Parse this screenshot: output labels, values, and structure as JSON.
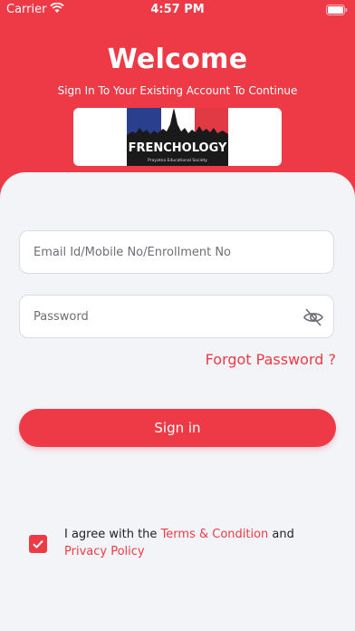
{
  "status_bar": {
    "carrier": "Carrier",
    "time": "4:57 PM"
  },
  "header": {
    "title": "Welcome",
    "subtitle": "Sign In To Your Existing Account To Continue",
    "logo_text": "FRENCHOLOGY",
    "logo_tagline": "Prayatna Educational Society"
  },
  "form": {
    "email_placeholder": "Email Id/Mobile No/Enrollment No",
    "password_placeholder": "Password",
    "forgot_label": "Forgot Password ?",
    "signin_label": "Sign in"
  },
  "agreement": {
    "checked": true,
    "prefix": "I agree with the ",
    "terms_label": "Terms & Condition",
    "middle": " and ",
    "privacy_label": "Privacy Policy"
  },
  "colors": {
    "primary": "#ee3a46",
    "background": "#f2f4f8"
  }
}
